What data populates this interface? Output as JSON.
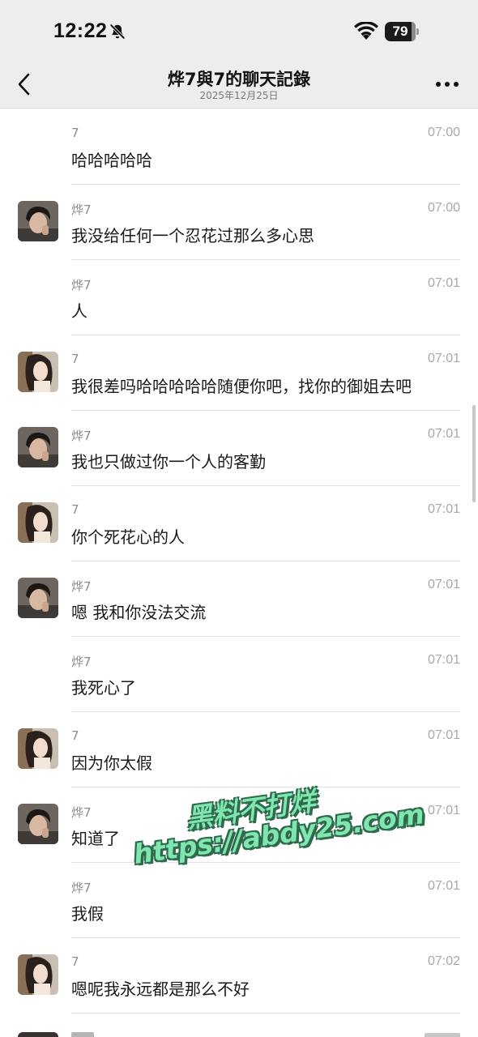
{
  "status_bar": {
    "time": "12:22",
    "battery": "79"
  },
  "nav": {
    "title": "烨7與7的聊天記錄",
    "subtitle": "2025年12月25日"
  },
  "messages": [
    {
      "sender": "7",
      "time": "07:00",
      "text": "哈哈哈哈哈",
      "avatar": "none"
    },
    {
      "sender": "烨7",
      "time": "07:00",
      "text": "我没给任何一个忍花过那么多心思",
      "avatar": "boy"
    },
    {
      "sender": "烨7",
      "time": "07:01",
      "text": "人",
      "avatar": "none"
    },
    {
      "sender": "7",
      "time": "07:01",
      "text": "我很差吗哈哈哈哈哈随便你吧，找你的御姐去吧",
      "avatar": "girl"
    },
    {
      "sender": "烨7",
      "time": "07:01",
      "text": "我也只做过你一个人的客勤",
      "avatar": "boy"
    },
    {
      "sender": "7",
      "time": "07:01",
      "text": "你个死花心的人",
      "avatar": "girl"
    },
    {
      "sender": "烨7",
      "time": "07:01",
      "text": "嗯 我和你没法交流",
      "avatar": "boy"
    },
    {
      "sender": "烨7",
      "time": "07:01",
      "text": "我死心了",
      "avatar": "none"
    },
    {
      "sender": "7",
      "time": "07:01",
      "text": "因为你太假",
      "avatar": "girl"
    },
    {
      "sender": "烨7",
      "time": "07:01",
      "text": "知道了",
      "avatar": "boy"
    },
    {
      "sender": "烨7",
      "time": "07:01",
      "text": "我假",
      "avatar": "none"
    },
    {
      "sender": "7",
      "time": "07:02",
      "text": "嗯呢我永远都是那么不好",
      "avatar": "girl"
    }
  ],
  "watermark": {
    "line1": "黑料不打烊",
    "line2": "https://abdy25.com"
  },
  "colors": {
    "nav_bg": "#ededed",
    "watermark_fill": "#7fe6b0",
    "watermark_stroke": "#2e6a4c"
  }
}
